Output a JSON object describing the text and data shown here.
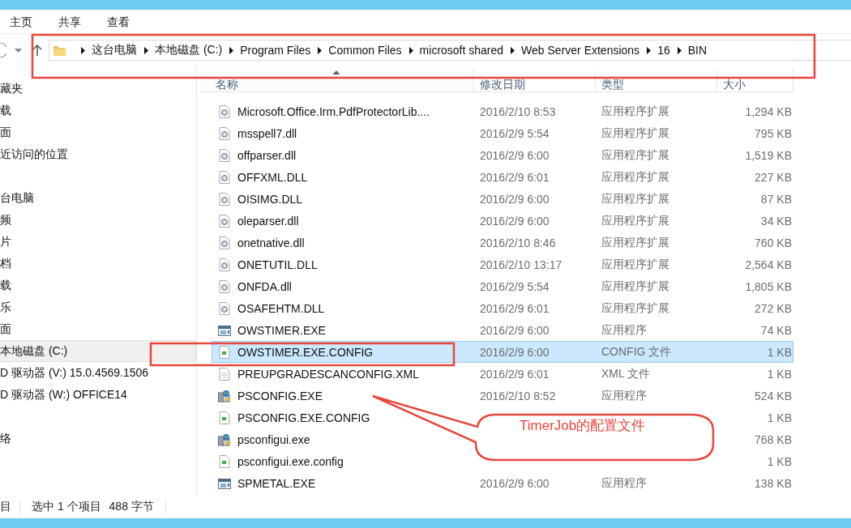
{
  "ribbon_tabs": [
    {
      "label": "主页"
    },
    {
      "label": "共享"
    },
    {
      "label": "查看"
    }
  ],
  "address_bar": {
    "path": [
      "这台电脑",
      "本地磁盘 (C:)",
      "Program Files",
      "Common Files",
      "microsoft shared",
      "Web Server Extensions",
      "16",
      "BIN"
    ]
  },
  "nav_pane": {
    "groups": [
      [
        {
          "label": "藏夹",
          "selected": false
        },
        {
          "label": "载",
          "selected": false
        },
        {
          "label": "面",
          "selected": false
        },
        {
          "label": "近访问的位置",
          "selected": false
        }
      ],
      [
        {
          "label": "台电脑",
          "selected": false
        },
        {
          "label": "频",
          "selected": false
        },
        {
          "label": "片",
          "selected": false
        },
        {
          "label": "档",
          "selected": false
        },
        {
          "label": "载",
          "selected": false
        },
        {
          "label": "乐",
          "selected": false
        },
        {
          "label": "面",
          "selected": false
        },
        {
          "label": "本地磁盘 (C:)",
          "selected": true
        },
        {
          "label": "D 驱动器 (V:) 15.0.4569.1506",
          "selected": false
        },
        {
          "label": "D 驱动器 (W:) OFFICE14",
          "selected": false
        }
      ],
      [
        {
          "label": "络",
          "selected": false
        }
      ]
    ]
  },
  "file_list": {
    "columns": [
      {
        "label": "名称",
        "sorted": true
      },
      {
        "label": "修改日期",
        "sorted": false
      },
      {
        "label": "类型",
        "sorted": false
      },
      {
        "label": "大小",
        "sorted": false
      }
    ],
    "rows": [
      {
        "kind": "dll",
        "name": "Microsoft.Office.Irm.PdfProtectorLib....",
        "date": "2016/2/10 8:53",
        "type": "应用程序扩展",
        "size": "1,294 KB",
        "selected": false
      },
      {
        "kind": "dll",
        "name": "msspell7.dll",
        "date": "2016/2/9 5:54",
        "type": "应用程序扩展",
        "size": "795 KB",
        "selected": false
      },
      {
        "kind": "dll",
        "name": "offparser.dll",
        "date": "2016/2/9 6:00",
        "type": "应用程序扩展",
        "size": "1,519 KB",
        "selected": false
      },
      {
        "kind": "dll",
        "name": "OFFXML.DLL",
        "date": "2016/2/9 6:01",
        "type": "应用程序扩展",
        "size": "227 KB",
        "selected": false
      },
      {
        "kind": "dll",
        "name": "OISIMG.DLL",
        "date": "2016/2/9 6:00",
        "type": "应用程序扩展",
        "size": "87 KB",
        "selected": false
      },
      {
        "kind": "dll",
        "name": "oleparser.dll",
        "date": "2016/2/9 6:00",
        "type": "应用程序扩展",
        "size": "34 KB",
        "selected": false
      },
      {
        "kind": "dll",
        "name": "onetnative.dll",
        "date": "2016/2/10 8:46",
        "type": "应用程序扩展",
        "size": "760 KB",
        "selected": false
      },
      {
        "kind": "dll",
        "name": "ONETUTIL.DLL",
        "date": "2016/2/10 13:17",
        "type": "应用程序扩展",
        "size": "2,564 KB",
        "selected": false
      },
      {
        "kind": "dll",
        "name": "ONFDA.dll",
        "date": "2016/2/9 5:54",
        "type": "应用程序扩展",
        "size": "1,805 KB",
        "selected": false
      },
      {
        "kind": "dll",
        "name": "OSAFEHTM.DLL",
        "date": "2016/2/9 6:01",
        "type": "应用程序扩展",
        "size": "272 KB",
        "selected": false
      },
      {
        "kind": "exe",
        "name": "OWSTIMER.EXE",
        "date": "2016/2/9 6:00",
        "type": "应用程序",
        "size": "74 KB",
        "selected": false
      },
      {
        "kind": "config",
        "name": "OWSTIMER.EXE.CONFIG",
        "date": "2016/2/9 6:00",
        "type": "CONFIG 文件",
        "size": "1 KB",
        "selected": true
      },
      {
        "kind": "xml",
        "name": "PREUPGRADESCANCONFIG.XML",
        "date": "2016/2/9 6:01",
        "type": "XML 文件",
        "size": "1 KB",
        "selected": false
      },
      {
        "kind": "installer",
        "name": "PSCONFIG.EXE",
        "date": "2016/2/10 8:52",
        "type": "应用程序",
        "size": "524 KB",
        "selected": false
      },
      {
        "kind": "config",
        "name": "PSCONFIG.EXE.CONFIG",
        "size": "1 KB",
        "selected": false
      },
      {
        "kind": "installer",
        "name": "psconfigui.exe",
        "size": "768 KB",
        "selected": false
      },
      {
        "kind": "config",
        "name": "psconfigui.exe.config",
        "size": "1 KB",
        "selected": false
      },
      {
        "kind": "exe",
        "name": "SPMETAL.EXE",
        "date": "2016/2/9 6:00",
        "type": "应用程序",
        "size": "138 KB",
        "selected": false
      }
    ]
  },
  "status_bar": {
    "items": [
      "目",
      "选中 1 个项目",
      "488 字节"
    ]
  },
  "annotations": {
    "callout": "TimerJob的配置文件"
  }
}
